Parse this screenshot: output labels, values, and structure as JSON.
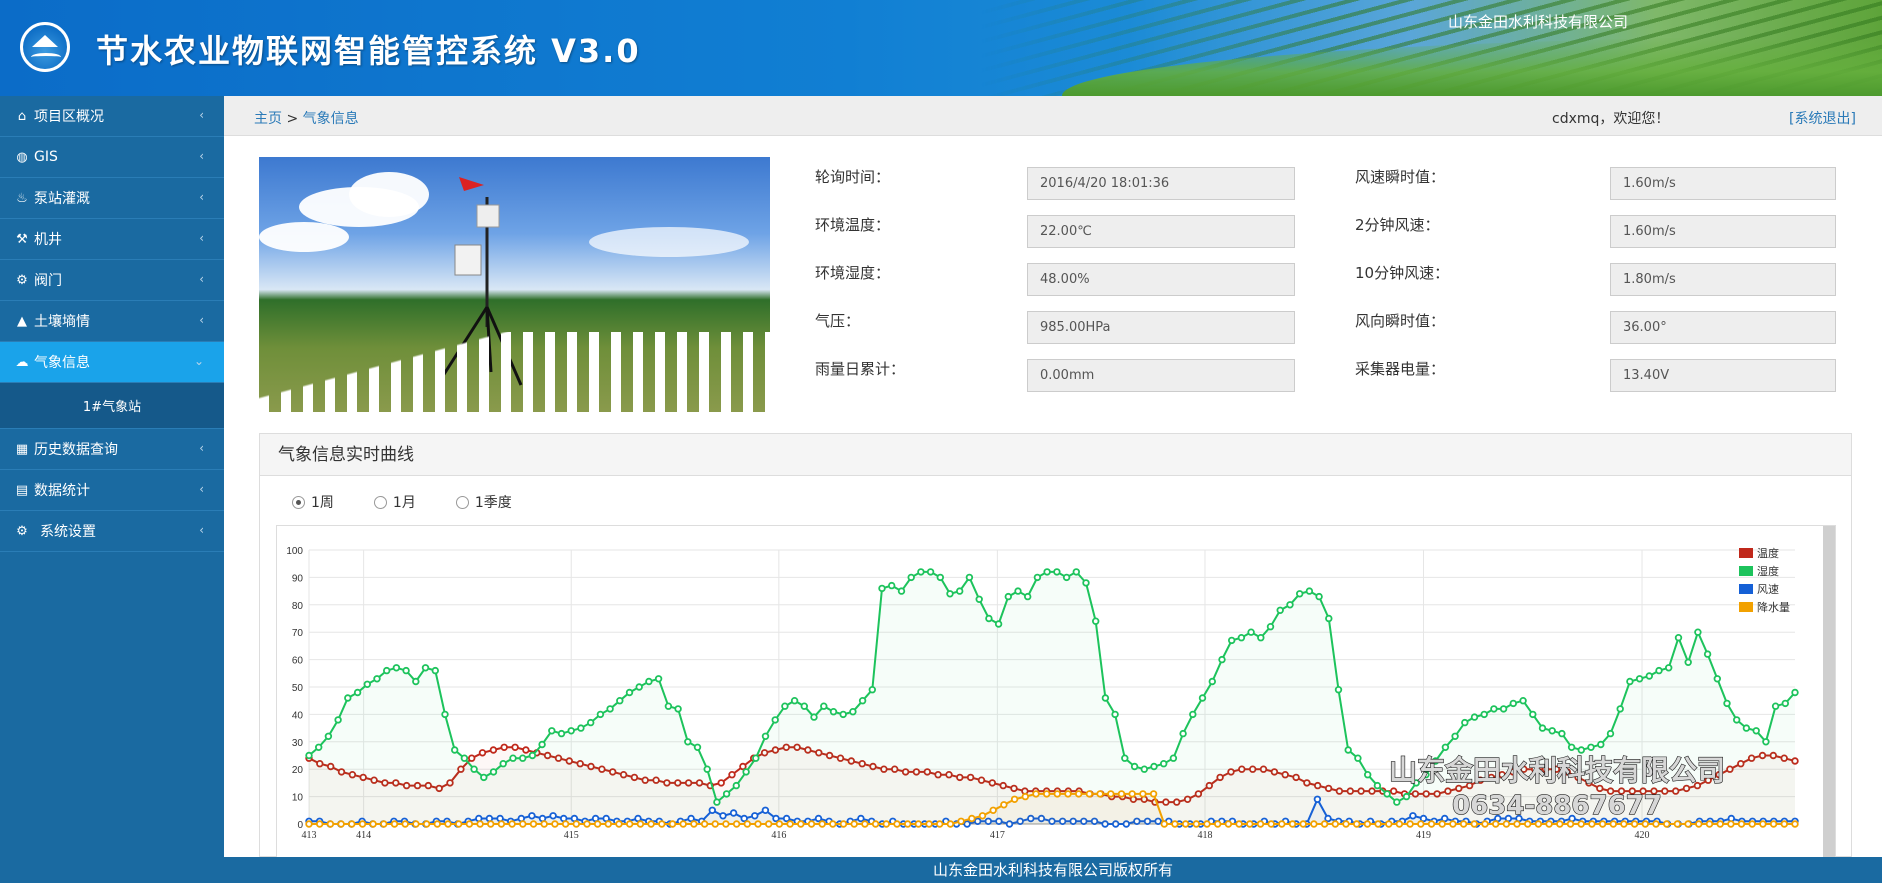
{
  "header": {
    "title": "节水农业物联网智能管控系统 V3.0",
    "company": "山东金田水利科技有限公司"
  },
  "sidebar": {
    "items": [
      {
        "label": "项目区概况",
        "icon": "home-icon",
        "glyph": "⌂"
      },
      {
        "label": "GIS",
        "icon": "globe-icon",
        "glyph": "◍"
      },
      {
        "label": "泵站灌溉",
        "icon": "flask-icon",
        "glyph": "♨"
      },
      {
        "label": "机井",
        "icon": "pump-icon",
        "glyph": "⚒"
      },
      {
        "label": "阀门",
        "icon": "valve-icon",
        "glyph": "⚙"
      },
      {
        "label": "土壤墒情",
        "icon": "soil-icon",
        "glyph": "▲"
      },
      {
        "label": "气象信息",
        "icon": "weather-icon",
        "glyph": "☁"
      },
      {
        "label": "历史数据查询",
        "icon": "calendar-icon",
        "glyph": "▦"
      },
      {
        "label": "数据统计",
        "icon": "stats-icon",
        "glyph": "▤"
      },
      {
        "label": "系统设置",
        "icon": "gears-icon",
        "glyph": "⚙"
      }
    ],
    "active_sub": "1#气象站"
  },
  "breadcrumb": {
    "home": "主页",
    "sep": ">",
    "current": "气象信息"
  },
  "user": {
    "welcome": "cdxmq，欢迎您！",
    "logout": "[系统退出]"
  },
  "info": {
    "left": [
      {
        "label": "轮询时间：",
        "value": "2016/4/20 18:01:36"
      },
      {
        "label": "环境温度：",
        "value": "22.00℃"
      },
      {
        "label": "环境湿度：",
        "value": "48.00%"
      },
      {
        "label": "气压：",
        "value": "985.00HPa"
      },
      {
        "label": "雨量日累计：",
        "value": "0.00mm"
      }
    ],
    "right": [
      {
        "label": "风速瞬时值：",
        "value": "1.60m/s"
      },
      {
        "label": "2分钟风速：",
        "value": "1.60m/s"
      },
      {
        "label": "10分钟风速：",
        "value": "1.80m/s"
      },
      {
        "label": "风向瞬时值：",
        "value": "36.00°"
      },
      {
        "label": "采集器电量：",
        "value": "13.40V"
      }
    ]
  },
  "panel": {
    "title": "气象信息实时曲线",
    "radios": [
      {
        "label": "1周",
        "checked": true
      },
      {
        "label": "1月",
        "checked": false
      },
      {
        "label": "1季度",
        "checked": false
      }
    ]
  },
  "watermark": {
    "line1": "山东金田水利科技有限公司",
    "line2": "0634-8867677"
  },
  "footer": {
    "text": "山东金田水利科技有限公司版权所有"
  },
  "chart_data": {
    "type": "line",
    "x_tick_labels": [
      "413",
      "414",
      "415",
      "416",
      "417",
      "418",
      "419",
      "420"
    ],
    "x_tick_positions": [
      0,
      5,
      24,
      43,
      63,
      82,
      102,
      122
    ],
    "x_max": 136,
    "ylim": [
      0,
      100
    ],
    "y_ticks": [
      0,
      10,
      20,
      30,
      40,
      50,
      60,
      70,
      80,
      90,
      100
    ],
    "grid": true,
    "legend_position": "top-right",
    "colors": {
      "温度": "#c0281b",
      "湿度": "#1dc35c",
      "风速": "#1560d6",
      "降水量": "#f2a100"
    },
    "series": [
      {
        "name": "温度",
        "values": [
          24,
          22,
          21,
          19,
          18,
          17,
          16,
          15,
          15,
          14,
          14,
          14,
          13,
          15,
          20,
          24,
          26,
          27,
          28,
          28,
          27,
          26,
          25,
          24,
          23,
          22,
          21,
          20,
          19,
          18,
          17,
          16,
          16,
          15,
          15,
          15,
          15,
          14,
          15,
          18,
          21,
          24,
          26,
          27,
          28,
          28,
          27,
          26,
          25,
          24,
          23,
          22,
          21,
          20,
          20,
          19,
          19,
          19,
          18,
          18,
          17,
          17,
          16,
          15,
          14,
          13,
          12,
          12,
          12,
          12,
          12,
          12,
          11,
          11,
          10,
          10,
          9,
          9,
          8,
          8,
          8,
          9,
          11,
          14,
          17,
          19,
          20,
          20,
          20,
          19,
          18,
          17,
          15,
          14,
          13,
          12,
          12,
          12,
          12,
          12,
          12,
          11,
          11,
          11,
          11,
          12,
          13,
          14,
          16,
          17,
          18,
          19,
          20,
          20,
          20,
          20,
          19,
          17,
          15,
          13,
          12,
          12,
          12,
          12,
          12,
          12,
          12,
          13,
          14,
          16,
          18,
          20,
          22,
          24,
          25,
          25,
          24,
          23
        ]
      },
      {
        "name": "湿度",
        "values": [
          25,
          28,
          32,
          38,
          46,
          48,
          51,
          53,
          56,
          57,
          56,
          52,
          57,
          56,
          40,
          27,
          24,
          20,
          17,
          19,
          22,
          24,
          24,
          25,
          29,
          34,
          33,
          34,
          35,
          37,
          40,
          42,
          45,
          48,
          50,
          52,
          53,
          43,
          42,
          30,
          28,
          20,
          8,
          11,
          14,
          19,
          24,
          32,
          38,
          43,
          45,
          43,
          39,
          43,
          41,
          40,
          41,
          45,
          49,
          86,
          87,
          85,
          90,
          92,
          92,
          90,
          84,
          85,
          90,
          82,
          75,
          73,
          83,
          85,
          83,
          90,
          92,
          92,
          90,
          92,
          88,
          74,
          46,
          40,
          24,
          21,
          20,
          21,
          22,
          24,
          33,
          40,
          46,
          52,
          60,
          67,
          68,
          70,
          68,
          72,
          78,
          80,
          84,
          85,
          83,
          75,
          49,
          27,
          24,
          18,
          14,
          11,
          8,
          10,
          15,
          18,
          23,
          28,
          32,
          37,
          39,
          40,
          42,
          42,
          44,
          45,
          40,
          35,
          34,
          33,
          28,
          27,
          28,
          29,
          33,
          42,
          52,
          53,
          54,
          56,
          57,
          68,
          59,
          70,
          62,
          53,
          44,
          38,
          35,
          34,
          30,
          43,
          44,
          48
        ]
      },
      {
        "name": "风速",
        "values": [
          1,
          1,
          0,
          0,
          0,
          1,
          0,
          0,
          1,
          1,
          0,
          0,
          1,
          1,
          0,
          1,
          2,
          2,
          2,
          1,
          2,
          3,
          2,
          3,
          2,
          2,
          1,
          2,
          2,
          1,
          1,
          2,
          1,
          1,
          0,
          1,
          2,
          1,
          5,
          3,
          4,
          2,
          3,
          5,
          2,
          2,
          1,
          1,
          2,
          1,
          0,
          1,
          2,
          1,
          0,
          1,
          0,
          0,
          0,
          0,
          1,
          0,
          0,
          1,
          1,
          1,
          0,
          1,
          2,
          2,
          1,
          1,
          1,
          1,
          1,
          0,
          0,
          0,
          1,
          1,
          1,
          1,
          0,
          0,
          0,
          1,
          1,
          1,
          0,
          0,
          1,
          0,
          1,
          0,
          0,
          9,
          2,
          1,
          1,
          0,
          1,
          0,
          1,
          1,
          3,
          2,
          1,
          2,
          1,
          1,
          0,
          1,
          2,
          2,
          2,
          1,
          1,
          1,
          1,
          2,
          1,
          1,
          1,
          1,
          1,
          1,
          1,
          1,
          0,
          0,
          0,
          1,
          1,
          1,
          2,
          1,
          1,
          1,
          1,
          1,
          1
        ]
      },
      {
        "name": "降水量",
        "values": [
          0,
          0,
          0,
          0,
          0,
          0,
          0,
          0,
          0,
          0,
          0,
          0,
          0,
          0,
          0,
          0,
          0,
          0,
          0,
          0,
          0,
          0,
          0,
          0,
          0,
          0,
          0,
          0,
          0,
          0,
          0,
          0,
          0,
          0,
          0,
          0,
          0,
          0,
          0,
          0,
          0,
          0,
          0,
          0,
          0,
          0,
          0,
          0,
          0,
          0,
          0,
          0,
          0,
          0,
          0,
          0,
          0,
          0,
          0,
          0,
          0,
          1,
          2,
          3,
          5,
          7,
          9,
          10,
          11,
          11,
          11,
          11,
          11,
          11,
          11,
          11,
          11,
          11,
          11,
          11,
          0,
          0,
          0,
          0,
          0,
          0,
          0,
          0,
          0,
          0,
          0,
          0,
          0,
          0,
          0,
          0,
          0,
          0,
          0,
          0,
          0,
          0,
          0,
          0,
          0,
          0,
          0,
          0,
          0,
          0,
          0,
          0,
          0,
          0,
          0,
          0,
          0,
          0,
          0,
          0,
          0,
          0,
          0,
          0,
          0,
          0,
          0,
          0,
          0,
          0,
          0,
          0,
          0,
          0,
          0,
          0,
          0,
          0,
          0,
          0
        ]
      }
    ]
  }
}
